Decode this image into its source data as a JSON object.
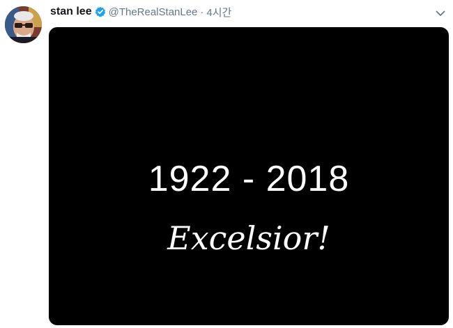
{
  "author": {
    "display_name": "stan lee",
    "handle": "@TheRealStanLee",
    "separator": "·",
    "timestamp": "4시간",
    "verified_icon": "verified-badge-icon",
    "avatar_icon": "profile-avatar"
  },
  "menu": {
    "icon": "chevron-down-icon"
  },
  "media": {
    "years": "1922 - 2018",
    "motto": "Excelsior!"
  },
  "colors": {
    "name": "#14171a",
    "secondary": "#657786",
    "verified": "#1da1f2",
    "media_background": "#000000",
    "media_text": "#ffffff"
  }
}
